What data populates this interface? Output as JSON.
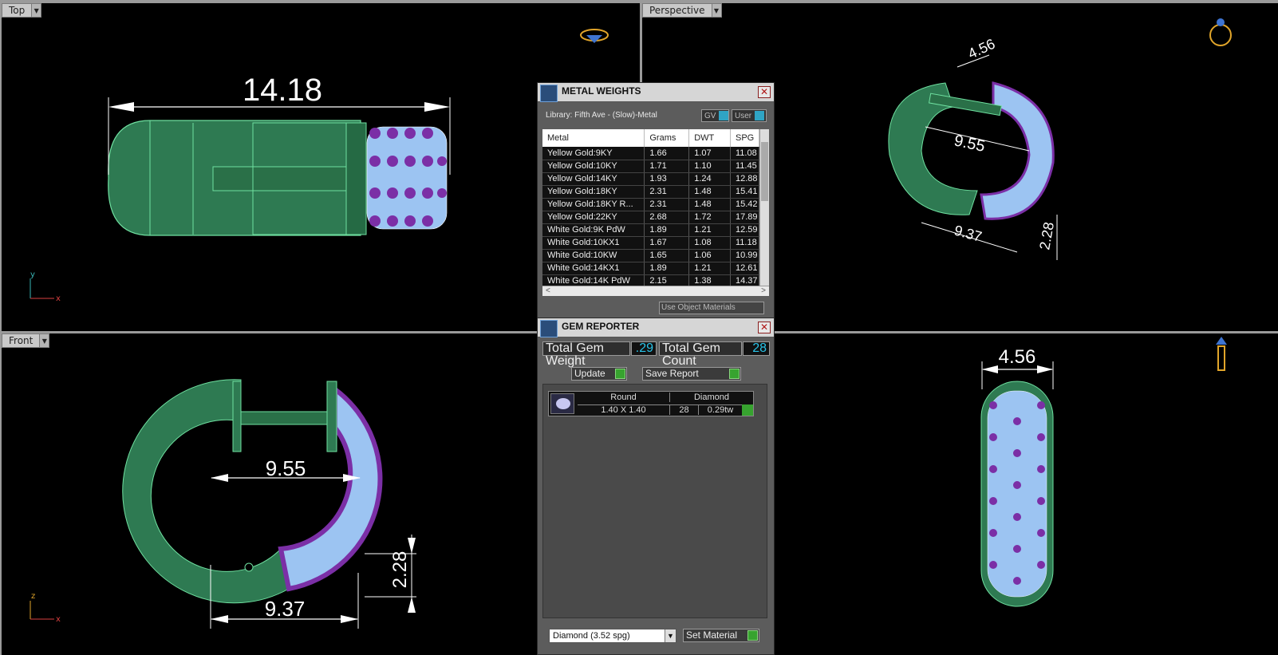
{
  "viewports": {
    "top": {
      "label": "Top",
      "dimension": "14.18",
      "axis_v": "y",
      "axis_h": "x"
    },
    "perspective": {
      "label": "Perspective",
      "dims": [
        "4.56",
        "9.55",
        "9.37",
        "2.28"
      ]
    },
    "front": {
      "label": "Front",
      "dims": [
        "9.55",
        "9.37",
        "2.28"
      ],
      "axis_v": "z",
      "axis_h": "x"
    },
    "right": {
      "dimension": "4.56"
    }
  },
  "metal_weights": {
    "title": "METAL WEIGHTS",
    "library": "Library: Fifth Ave - (Slow)-Metal",
    "toggle_gv": "GV",
    "toggle_user": "User",
    "columns": [
      "Metal",
      "Grams",
      "DWT",
      "SPG"
    ],
    "rows": [
      [
        "Yellow Gold:9KY",
        "1.66",
        "1.07",
        "11.08"
      ],
      [
        "Yellow Gold:10KY",
        "1.71",
        "1.10",
        "11.45"
      ],
      [
        "Yellow Gold:14KY",
        "1.93",
        "1.24",
        "12.88"
      ],
      [
        "Yellow Gold:18KY",
        "2.31",
        "1.48",
        "15.41"
      ],
      [
        "Yellow Gold:18KY R...",
        "2.31",
        "1.48",
        "15.42"
      ],
      [
        "Yellow Gold:22KY",
        "2.68",
        "1.72",
        "17.89"
      ],
      [
        "White Gold:9K PdW",
        "1.89",
        "1.21",
        "12.59"
      ],
      [
        "White Gold:10KX1",
        "1.67",
        "1.08",
        "11.18"
      ],
      [
        "White Gold:10KW",
        "1.65",
        "1.06",
        "10.99"
      ],
      [
        "White Gold:14KX1",
        "1.89",
        "1.21",
        "12.61"
      ],
      [
        "White Gold:14K PdW",
        "2.15",
        "1.38",
        "14.37"
      ]
    ],
    "use_object_materials": "Use Object Materials"
  },
  "gem_reporter": {
    "title": "GEM REPORTER",
    "total_weight_label": "Total Gem Weight",
    "total_weight_value": ".29",
    "total_count_label": "Total Gem Count",
    "total_count_value": "28",
    "update_label": "Update",
    "save_report_label": "Save Report",
    "gem": {
      "shape": "Round",
      "size": "1.40 X 1.40",
      "type": "Diamond",
      "count": "28",
      "weight": "0.29tw"
    },
    "material_select": "Diamond     (3.52 spg)",
    "set_material_label": "Set Material"
  },
  "colors": {
    "metal": "#3f9a68",
    "gem": "#9cc4f2",
    "prong": "#7b2fa6",
    "dimension": "#ffffff",
    "accent": "#29c4e9"
  }
}
